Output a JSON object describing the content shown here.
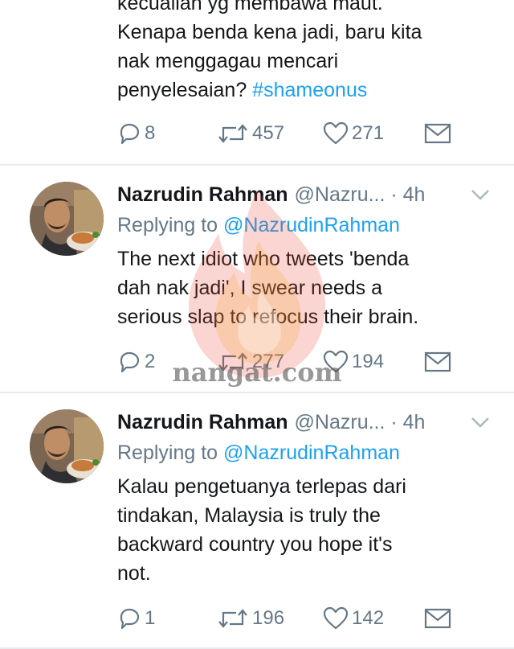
{
  "tweets": [
    {
      "lines": [
        "kecualian yg membawa maut.",
        "Kenapa benda kena jadi, baru kita",
        "nak menggagau mencari",
        "penyelesaian? "
      ],
      "hashtag": "#shameonus",
      "replies": "8",
      "retweets": "457",
      "likes": "271"
    },
    {
      "name": "Nazrudin Rahman",
      "handle": "@Nazru... · 4h",
      "replying_prefix": "Replying to ",
      "replying_to": "@NazrudinRahman",
      "lines": [
        "The next idiot who tweets 'benda",
        "dah nak jadi', I swear needs a",
        "serious slap to refocus their brain."
      ],
      "replies": "2",
      "retweets": "277",
      "likes": "194"
    },
    {
      "name": "Nazrudin Rahman",
      "handle": "@Nazru... · 4h",
      "replying_prefix": "Replying to ",
      "replying_to": "@NazrudinRahman",
      "lines": [
        "Kalau pengetuanya terlepas dari",
        "tindakan, Malaysia is truly the",
        "backward country you hope it's",
        "not."
      ],
      "replies": "1",
      "retweets": "196",
      "likes": "142"
    }
  ],
  "watermark": {
    "text": "nangat.com"
  },
  "colors": {
    "link": "#1da1f2",
    "muted": "#657786",
    "text": "#14171a",
    "divider": "#e6ecf0"
  },
  "icons": {
    "reply": "reply-icon",
    "retweet": "retweet-icon",
    "like": "heart-icon",
    "message": "envelope-icon",
    "caret": "chevron-down-icon"
  }
}
